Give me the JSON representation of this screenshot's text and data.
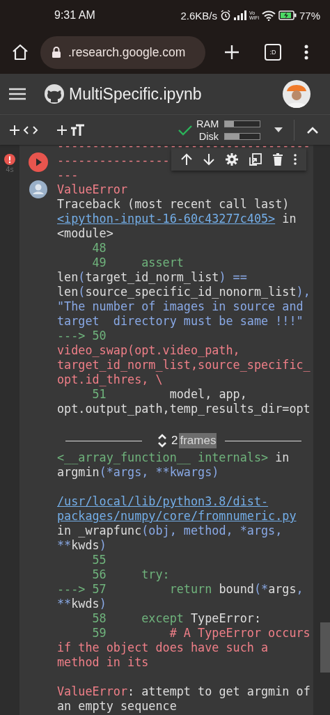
{
  "status_bar": {
    "time": "9:31 AM",
    "net_speed": "2.6KB/s",
    "vowifi": [
      "Vo",
      "WiFi"
    ],
    "battery": "77%"
  },
  "browser": {
    "url": ".research.google.com",
    "tab_label": ":D"
  },
  "notebook": {
    "title": "MultiSpecific.ipynb"
  },
  "toolbar": {
    "resources": [
      {
        "label": "RAM",
        "level": 0.25
      },
      {
        "label": "Disk",
        "level": 0.42
      }
    ]
  },
  "cell": {
    "exec_time": "4s"
  },
  "output": {
    "lines_before": [
      {
        "segments": [
          {
            "text": "------------------------------------",
            "kind": "error"
          }
        ]
      },
      {
        "segments": [
          {
            "text": "----------------",
            "kind": "error"
          }
        ]
      },
      {
        "segments": [
          {
            "text": "---",
            "kind": "error"
          }
        ]
      },
      {
        "segments": [
          {
            "text": "ValueError",
            "kind": "error"
          }
        ]
      },
      {
        "segments": [
          {
            "text": "Traceback (most recent call last)",
            "kind": "plain"
          }
        ]
      },
      {
        "segments": [
          {
            "text": "<ipython-input-16-60c43277c405>",
            "kind": "link"
          },
          {
            "text": " in",
            "kind": "plain"
          }
        ]
      },
      {
        "segments": [
          {
            "text": "<module>",
            "kind": "plain"
          }
        ]
      },
      {
        "segments": [
          {
            "text": "     48",
            "kind": "green"
          }
        ]
      },
      {
        "segments": [
          {
            "text": "     49     assert",
            "kind": "green"
          }
        ]
      },
      {
        "segments": [
          {
            "text": "len",
            "kind": "plain"
          },
          {
            "text": "(",
            "kind": "blue"
          },
          {
            "text": "target_id_norm_list",
            "kind": "plain"
          },
          {
            "text": ") ==",
            "kind": "blue"
          }
        ]
      },
      {
        "segments": [
          {
            "text": "len",
            "kind": "plain"
          },
          {
            "text": "(",
            "kind": "blue"
          },
          {
            "text": "source_specific_id_nonorm_list",
            "kind": "plain"
          },
          {
            "text": "),",
            "kind": "blue"
          }
        ]
      },
      {
        "segments": [
          {
            "text": "\"The number of images in source and",
            "kind": "blue"
          }
        ]
      },
      {
        "segments": [
          {
            "text": "target  directory must be same !!!\"",
            "kind": "blue"
          }
        ]
      },
      {
        "segments": [
          {
            "text": "---> 50",
            "kind": "green"
          }
        ]
      },
      {
        "segments": [
          {
            "text": "video_swap(opt.video_path,",
            "kind": "error"
          }
        ]
      },
      {
        "segments": [
          {
            "text": "target_id_norm_list,source_specific_",
            "kind": "error"
          }
        ]
      },
      {
        "segments": [
          {
            "text": "opt.id_thres, \\",
            "kind": "error"
          }
        ]
      },
      {
        "segments": [
          {
            "text": "     51",
            "kind": "green"
          },
          {
            "text": "         model, app,",
            "kind": "plain"
          }
        ]
      },
      {
        "segments": [
          {
            "text": "opt.output_path,temp_results_dir=opt",
            "kind": "plain"
          }
        ]
      }
    ],
    "frames": {
      "count": "2",
      "label": "frames"
    },
    "lines_after": [
      {
        "segments": [
          {
            "text": "<__array_function__ internals>",
            "kind": "green"
          },
          {
            "text": " in",
            "kind": "plain"
          }
        ]
      },
      {
        "segments": [
          {
            "text": "argmin",
            "kind": "plain"
          },
          {
            "text": "(*args, **kwargs)",
            "kind": "blue"
          }
        ]
      },
      {
        "gap_before": true,
        "segments": [
          {
            "text": "/usr/local/lib/python3.8/dist-",
            "kind": "link"
          }
        ]
      },
      {
        "segments": [
          {
            "text": "packages/numpy/core/fromnumeric.py",
            "kind": "link"
          }
        ]
      },
      {
        "segments": [
          {
            "text": "in _wrapfunc",
            "kind": "plain"
          },
          {
            "text": "(obj, method, *args,",
            "kind": "blue"
          }
        ]
      },
      {
        "segments": [
          {
            "text": "**",
            "kind": "blue"
          },
          {
            "text": "kwds",
            "kind": "plain"
          },
          {
            "text": ")",
            "kind": "blue"
          }
        ]
      },
      {
        "segments": [
          {
            "text": "     55",
            "kind": "green"
          }
        ]
      },
      {
        "segments": [
          {
            "text": "     56     try:",
            "kind": "green"
          }
        ]
      },
      {
        "segments": [
          {
            "text": "---> 57         return",
            "kind": "green"
          },
          {
            "text": " bound",
            "kind": "plain"
          },
          {
            "text": "(*",
            "kind": "blue"
          },
          {
            "text": "args",
            "kind": "plain"
          },
          {
            "text": ",",
            "kind": "blue"
          }
        ]
      },
      {
        "segments": [
          {
            "text": "**",
            "kind": "blue"
          },
          {
            "text": "kwds",
            "kind": "plain"
          },
          {
            "text": ")",
            "kind": "blue"
          }
        ]
      },
      {
        "segments": [
          {
            "text": "     58     except",
            "kind": "green"
          },
          {
            "text": " TypeError:",
            "kind": "plain"
          }
        ]
      },
      {
        "segments": [
          {
            "text": "     59",
            "kind": "green"
          },
          {
            "text": "         # A TypeError occurs",
            "kind": "error"
          }
        ]
      },
      {
        "segments": [
          {
            "text": "if the object does have such a",
            "kind": "error"
          }
        ]
      },
      {
        "segments": [
          {
            "text": "method in its",
            "kind": "error"
          }
        ]
      },
      {
        "gap_before": true,
        "segments": [
          {
            "text": "ValueError",
            "kind": "error"
          },
          {
            "text": ": attempt to get argmin of",
            "kind": "plain"
          }
        ]
      },
      {
        "segments": [
          {
            "text": "an empty sequence",
            "kind": "plain"
          }
        ]
      }
    ]
  }
}
